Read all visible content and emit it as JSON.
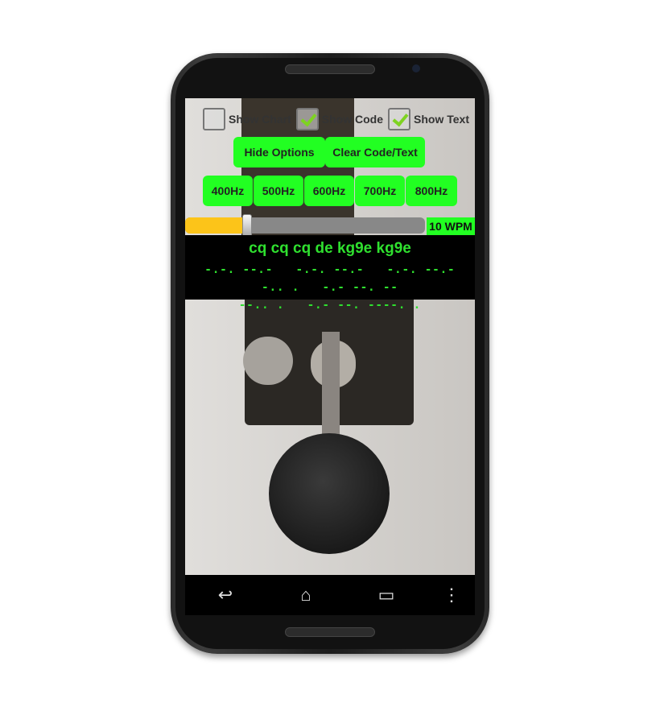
{
  "checkboxes": [
    {
      "label": "Show Chart",
      "checked": false
    },
    {
      "label": "Show Code",
      "checked": true
    },
    {
      "label": "Show Text",
      "checked": true
    }
  ],
  "buttons": {
    "hide_options": "Hide  Options",
    "clear": "Clear Code/Text"
  },
  "frequencies": [
    "400Hz",
    "500Hz",
    "600Hz",
    "700Hz",
    "800Hz"
  ],
  "speed": {
    "label": "10 WPM",
    "fraction": 0.26
  },
  "decoded_text": "cq cq cq de kg9e kg9e",
  "morse_code": "-.-. --.-   -.-. --.-   -.-. --.-   -.. .   -.- --. --\n--.. .   -.- --. ----. .",
  "nav": {
    "back": "↩",
    "home": "⌂",
    "recents": "▭",
    "menu": "⋮"
  },
  "colors": {
    "button": "#22ff22",
    "slider": "#fcc419",
    "text": "#2fe02f"
  }
}
